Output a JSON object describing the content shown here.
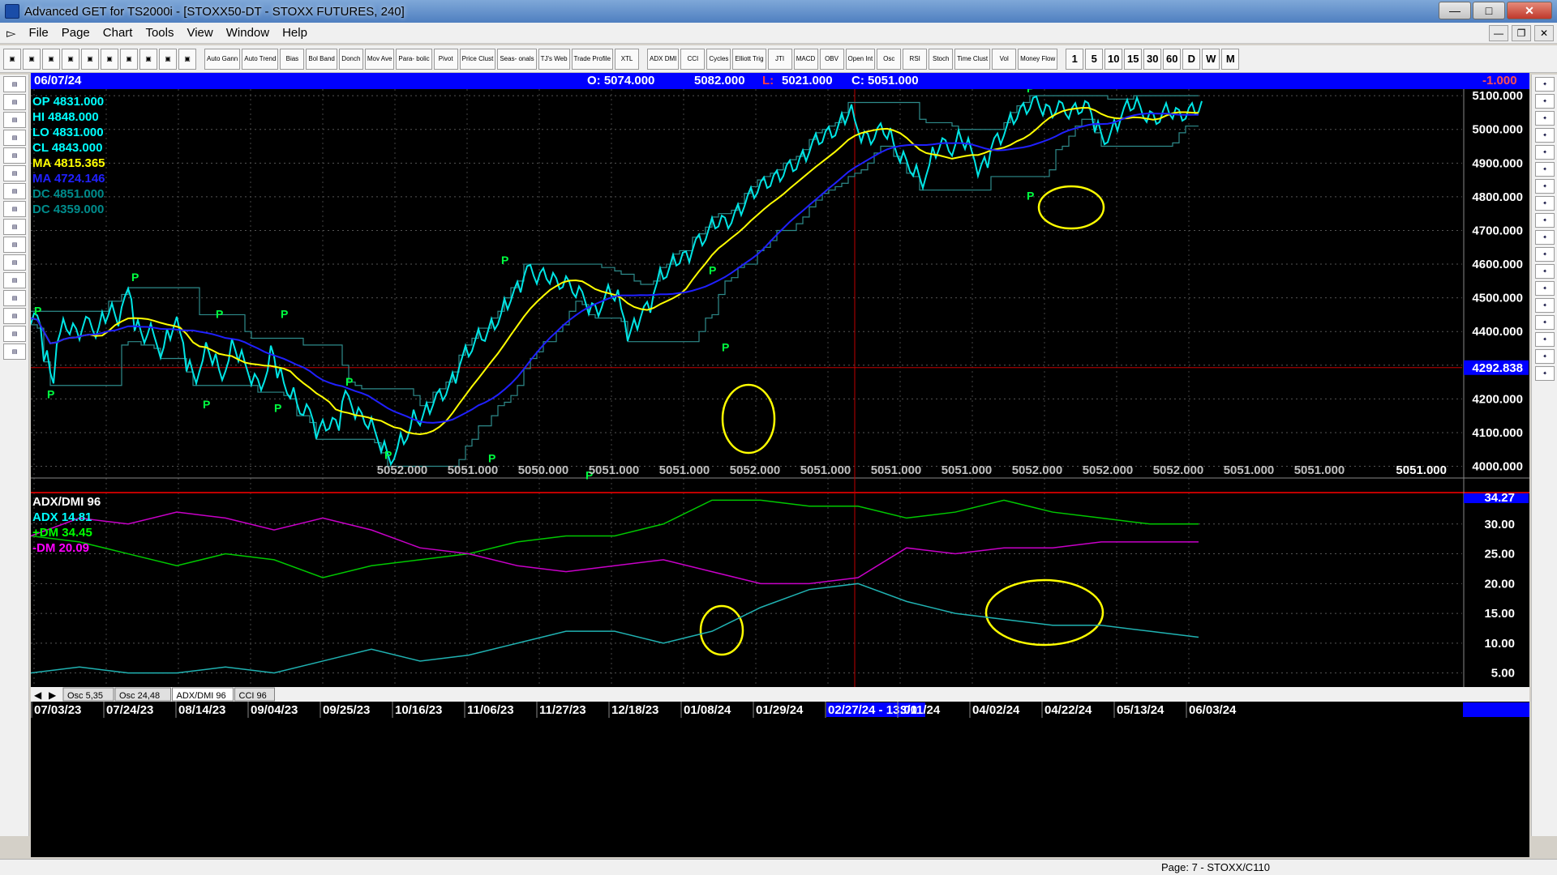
{
  "window": {
    "title": "Advanced GET for TS2000i - [STOXX50-DT - STOXX FUTURES, 240]"
  },
  "menu": [
    "File",
    "Page",
    "Chart",
    "Tools",
    "View",
    "Window",
    "Help"
  ],
  "toolbar": [
    "Auto Gann",
    "Auto Trend",
    "Bias",
    "Bol Band",
    "Donch",
    "Mov Ave",
    "Para- bolic",
    "Pivot",
    "Price Clust",
    "Seas- onals",
    "TJ's Web",
    "Trade Profile",
    "XTL",
    "ADX DMI",
    "CCI",
    "Cycles",
    "Elliott Trig",
    "JTI",
    "MACD",
    "OBV",
    "Open Int",
    "Osc",
    "RSI",
    "Stoch",
    "Time Clust",
    "Vol",
    "Money Flow"
  ],
  "timeframes": [
    "1",
    "5",
    "10",
    "15",
    "30",
    "60",
    "D",
    "W",
    "M"
  ],
  "infobar": {
    "date": "06/07/24",
    "open": "O: 5074.000",
    "high": "5082.000",
    "low_label": "L:",
    "low": "5021.000",
    "close": "C: 5051.000",
    "change": "-1.000"
  },
  "legend": [
    {
      "label": "OP  4831.000",
      "color": "#00ffff"
    },
    {
      "label": "HI   4848.000",
      "color": "#00ffff"
    },
    {
      "label": "LO  4831.000",
      "color": "#00ffff"
    },
    {
      "label": "CL  4843.000",
      "color": "#00ffff"
    },
    {
      "label": "MA  4815.365",
      "color": "#ffff00"
    },
    {
      "label": "MA  4724.146",
      "color": "#2020ff"
    },
    {
      "label": "DC  4851.000",
      "color": "#008b8b"
    },
    {
      "label": "DC  4359.000",
      "color": "#008b8b"
    }
  ],
  "price_axis": [
    "5100.000",
    "5000.000",
    "4900.000",
    "4800.000",
    "4700.000",
    "4600.000",
    "4500.000",
    "4400.000",
    "4300.000",
    "4200.000",
    "4100.000",
    "4000.000"
  ],
  "crosshair_price": "4292.838",
  "bottom_prices": [
    "5052.000",
    "5051.000",
    "5050.000",
    "5051.000",
    "5051.000",
    "5052.000",
    "5051.000",
    "5051.000",
    "5051.000",
    "5052.000",
    "5052.000",
    "5052.000",
    "5051.000",
    "5051.000"
  ],
  "last_price": "5051.000",
  "adx_legend": [
    {
      "label": "ADX/DMI 96",
      "color": "#ffffff"
    },
    {
      "label": "ADX  14.81",
      "color": "#00ffff"
    },
    {
      "label": "+DM  34.45",
      "color": "#00ff00"
    },
    {
      "label": "-DM   20.09",
      "color": "#ff00ff"
    }
  ],
  "adx_axis": [
    "34.27",
    "30.00",
    "25.00",
    "20.00",
    "15.00",
    "10.00",
    "5.00"
  ],
  "osc_tabs": [
    "Osc 5,35",
    "Osc 24,48",
    "ADX/DMI 96",
    "CCI 96"
  ],
  "date_axis": [
    "07/03/23",
    "07/24/23",
    "08/14/23",
    "09/04/23",
    "09/25/23",
    "10/16/23",
    "11/06/23",
    "11/27/23",
    "12/18/23",
    "01/08/24",
    "01/29/24",
    "02/27/24 - 13:00",
    "3/11/24",
    "04/02/24",
    "04/22/24",
    "05/13/24",
    "06/03/24"
  ],
  "status": {
    "page": "Page: 7 - STOXX/C110"
  },
  "pivot_label": "P",
  "chart_data": {
    "type": "line",
    "title": "",
    "price": {
      "ylim": [
        3970,
        5110
      ],
      "x": [
        0,
        8,
        16,
        24,
        32,
        40,
        48,
        56,
        64,
        72,
        80,
        88,
        96,
        104,
        112,
        120,
        128,
        136,
        144,
        152,
        160,
        168,
        176,
        184,
        192,
        200,
        208,
        216,
        224,
        232,
        240,
        248,
        256,
        264,
        272,
        280,
        288,
        296,
        304,
        312,
        320,
        328,
        336,
        344,
        352,
        360,
        368,
        376,
        384,
        392,
        400,
        408,
        416,
        424,
        432,
        440,
        448,
        456,
        464,
        472,
        480,
        488,
        496,
        504,
        512,
        520,
        528,
        536,
        544,
        552,
        560,
        568,
        576,
        584,
        592,
        600,
        608,
        616,
        624,
        632,
        640,
        648,
        656,
        664,
        672,
        680,
        688,
        696,
        704,
        712,
        720,
        728,
        736,
        744,
        752,
        760,
        768,
        776,
        784,
        792,
        800,
        808,
        816,
        824,
        832,
        840,
        848,
        856,
        864,
        872,
        880,
        888,
        896,
        904,
        912,
        920,
        928,
        936,
        944,
        952,
        960,
        968,
        976,
        984,
        992,
        1000,
        1008,
        1016,
        1024,
        1032,
        1040,
        1048,
        1056,
        1064,
        1072,
        1080,
        1088,
        1096,
        1104,
        1112,
        1120,
        1128,
        1136,
        1144,
        1152,
        1160,
        1168,
        1176,
        1184,
        1192,
        1200,
        1208,
        1216,
        1224,
        1232,
        1240,
        1248,
        1256,
        1264,
        1272,
        1280,
        1288,
        1296,
        1304,
        1312,
        1320,
        1328,
        1336,
        1344,
        1352,
        1360,
        1368,
        1376,
        1384,
        1392,
        1400,
        1408,
        1416,
        1424,
        1432,
        1440
      ],
      "close": [
        4440,
        4430,
        4330,
        4260,
        4380,
        4420,
        4410,
        4390,
        4430,
        4420,
        4400,
        4440,
        4470,
        4430,
        4490,
        4510,
        4420,
        4380,
        4410,
        4370,
        4340,
        4390,
        4430,
        4380,
        4300,
        4260,
        4300,
        4350,
        4320,
        4270,
        4300,
        4360,
        4330,
        4290,
        4260,
        4240,
        4270,
        4340,
        4280,
        4230,
        4220,
        4170,
        4170,
        4150,
        4100,
        4120,
        4130,
        4120,
        4210,
        4190,
        4160,
        4140,
        4130,
        4090,
        4060,
        4020,
        4040,
        4080,
        4100,
        4150,
        4140,
        4170,
        4200,
        4210,
        4230,
        4260,
        4310,
        4340,
        4360,
        4390,
        4390,
        4420,
        4440,
        4480,
        4510,
        4530,
        4580,
        4580,
        4560,
        4570,
        4560,
        4540,
        4550,
        4530,
        4520,
        4500,
        4470,
        4460,
        4490,
        4520,
        4510,
        4450,
        4390,
        4420,
        4460,
        4470,
        4530,
        4570,
        4580,
        4610,
        4620,
        4620,
        4660,
        4670,
        4690,
        4720,
        4730,
        4720,
        4740,
        4760,
        4790,
        4810,
        4830,
        4840,
        4850,
        4860,
        4880,
        4890,
        4900,
        4920,
        4950,
        4970,
        4980,
        4990,
        5000,
        5030,
        5060,
        5010,
        4980,
        4970,
        4990,
        5000,
        4990,
        4940,
        4920,
        4890,
        4880,
        4840,
        4880,
        4930,
        4960,
        4950,
        4940,
        4980,
        4960,
        4920,
        4880,
        4900,
        4960,
        4970,
        5000,
        5030,
        5050,
        5060,
        5080,
        5080,
        5060,
        5050,
        5070,
        5060,
        5050,
        5060,
        5070,
        5060,
        5010,
        4970,
        4980,
        5010,
        5050,
        5070,
        5080,
        5050,
        5040,
        5030,
        5040,
        5060,
        5050,
        5040,
        5050,
        5060,
        5070,
        5060,
        5050,
        5050,
        5050,
        5050,
        5050,
        5051,
        5051
      ]
    },
    "adx": {
      "ylim": [
        4,
        35
      ],
      "x": [
        0,
        60,
        120,
        180,
        240,
        300,
        360,
        420,
        480,
        540,
        600,
        660,
        720,
        780,
        840,
        900,
        960,
        1020,
        1080,
        1140,
        1200,
        1260,
        1320,
        1380,
        1440
      ],
      "adx": [
        5,
        6,
        5,
        5,
        6,
        5,
        7,
        9,
        7,
        8,
        10,
        12,
        12,
        10,
        12,
        16,
        19,
        20,
        17,
        15,
        14,
        13,
        13,
        12,
        11
      ],
      "plus_dm": [
        28,
        27,
        25,
        23,
        25,
        24,
        21,
        23,
        24,
        25,
        27,
        28,
        28,
        30,
        34,
        34,
        33,
        33,
        31,
        32,
        34,
        32,
        31,
        30,
        30
      ],
      "minus_dm": [
        28,
        31,
        30,
        32,
        31,
        29,
        31,
        29,
        26,
        25,
        23,
        22,
        23,
        24,
        22,
        20,
        20,
        21,
        26,
        25,
        26,
        26,
        27,
        27,
        27
      ]
    }
  }
}
